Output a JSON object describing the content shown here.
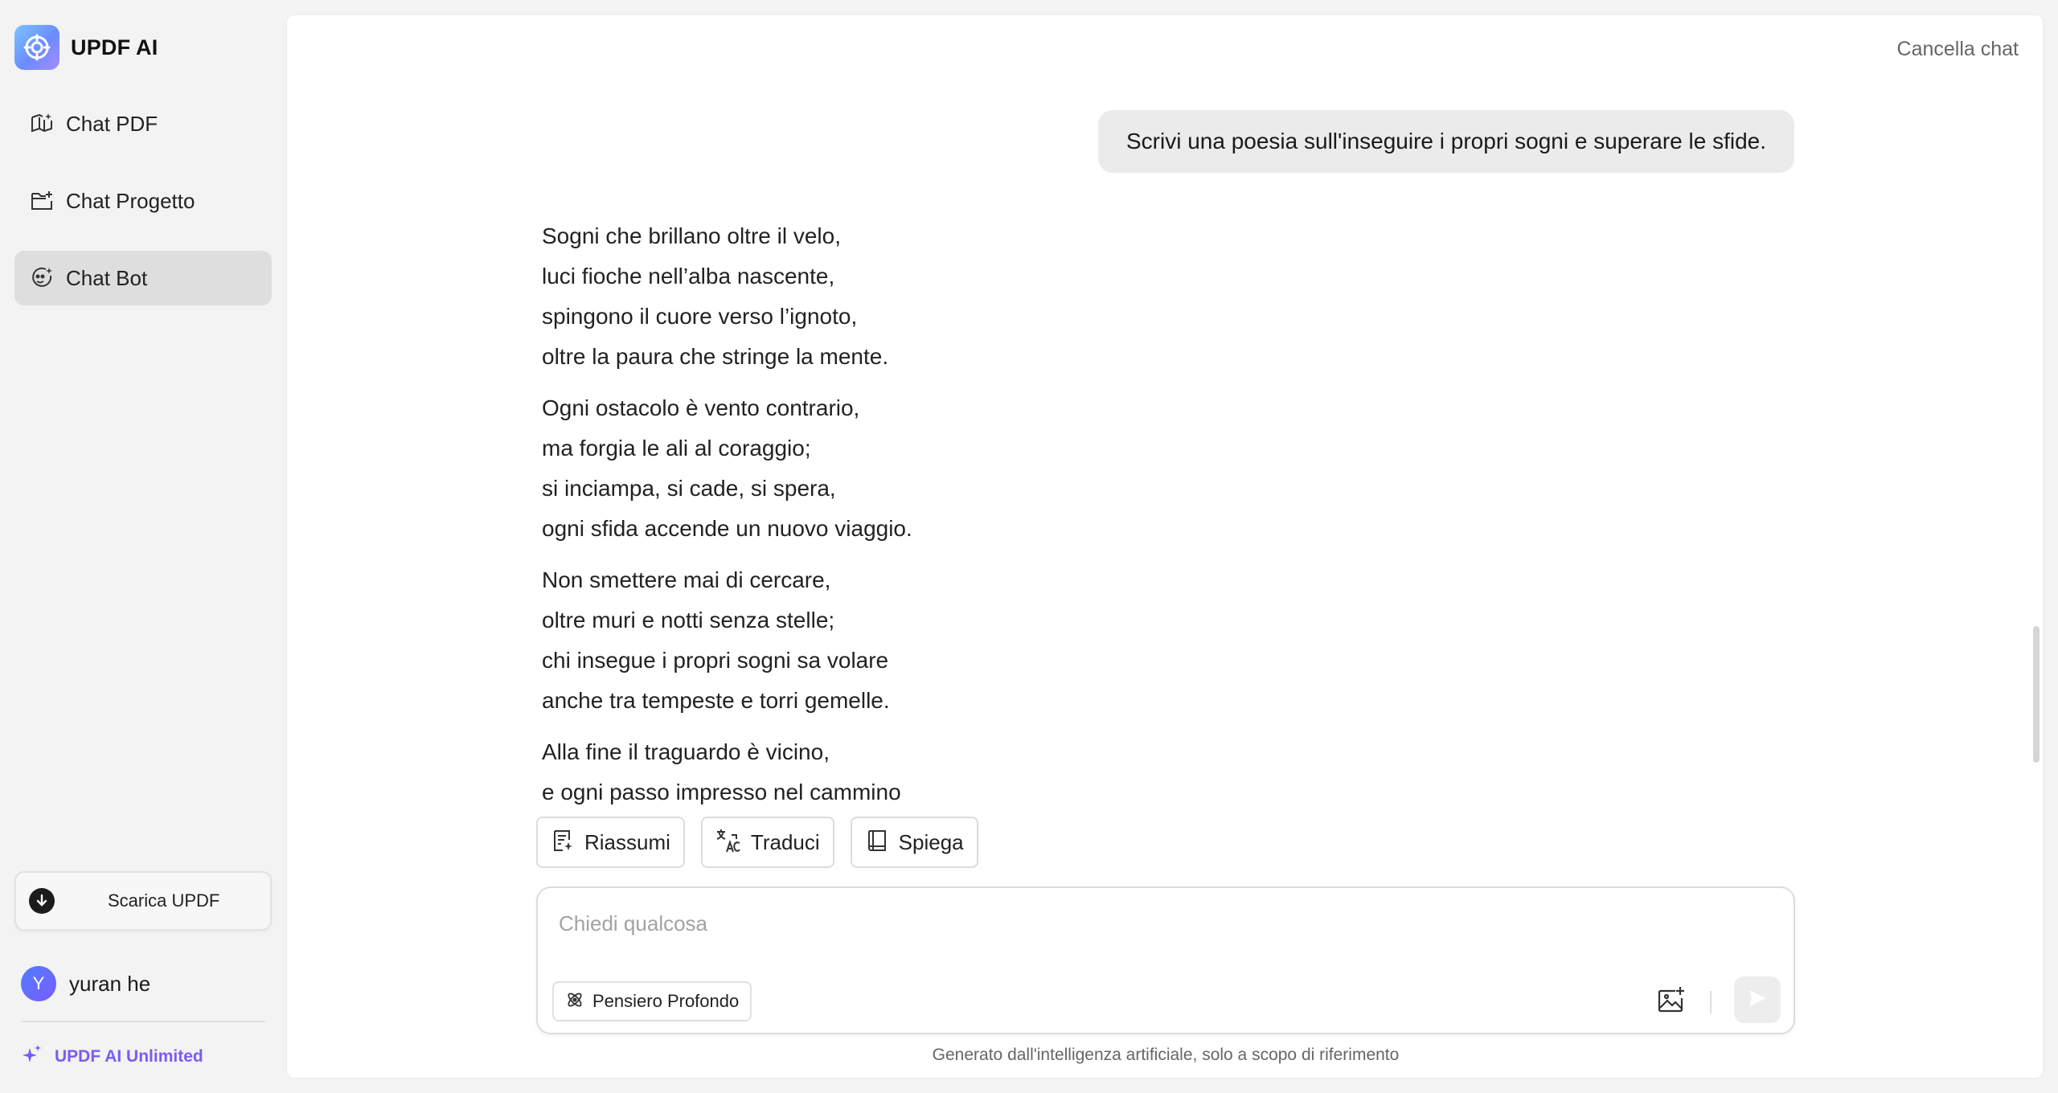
{
  "sidebar": {
    "brand": "UPDF AI",
    "items": [
      {
        "label": "Chat PDF",
        "icon": "book-ai-icon",
        "active": false
      },
      {
        "label": "Chat Progetto",
        "icon": "folder-plus-icon",
        "active": false
      },
      {
        "label": "Chat Bot",
        "icon": "bot-face-icon",
        "active": true
      }
    ],
    "download_label": "Scarica UPDF",
    "user": {
      "initial": "Y",
      "name": "yuran he"
    },
    "unlimited_label": "UPDF AI Unlimited"
  },
  "header": {
    "clear_chat": "Cancella chat"
  },
  "chat": {
    "user_message": "Scrivi una poesia sull'inseguire i propri sogni e superare le sfide.",
    "poem": [
      [
        "Sogni che brillano oltre il velo,",
        "luci fioche nell’alba nascente,",
        "spingono il cuore verso l’ignoto,",
        "oltre la paura che stringe la mente."
      ],
      [
        "Ogni ostacolo è vento contrario,",
        "ma forgia le ali al coraggio;",
        "si inciampa, si cade, si spera,",
        "ogni sfida accende un nuovo viaggio."
      ],
      [
        "Non smettere mai di cercare,",
        "oltre muri e notti senza stelle;",
        "chi insegue i propri sogni sa volare",
        "anche tra tempeste e torri gemelle."
      ],
      [
        "Alla fine il traguardo è vicino,",
        "e ogni passo impresso nel cammino"
      ]
    ]
  },
  "actions": {
    "summarize": "Riassumi",
    "translate": "Traduci",
    "explain": "Spiega"
  },
  "composer": {
    "placeholder": "Chiedi qualcosa",
    "deep_think": "Pensiero Profondo"
  },
  "footer": {
    "note": "Generato dall'intelligenza artificiale, solo a scopo di riferimento"
  },
  "colors": {
    "accent": "#7a5cf0",
    "active_nav": "#dedede",
    "bubble": "#ebebeb"
  }
}
